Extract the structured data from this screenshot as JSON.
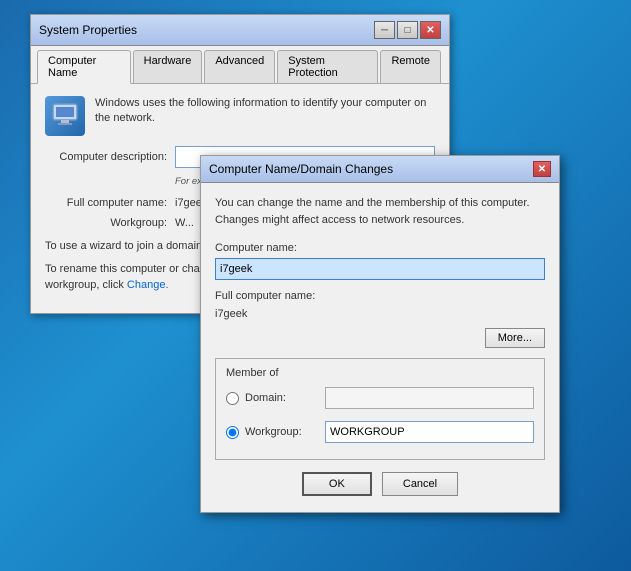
{
  "syswindow": {
    "title": "System Properties",
    "close": "✕",
    "minimize": "─",
    "maximize": "□",
    "tabs": [
      {
        "label": "Computer Name",
        "active": true
      },
      {
        "label": "Hardware",
        "active": false
      },
      {
        "label": "Advanced",
        "active": false
      },
      {
        "label": "System Protection",
        "active": false
      },
      {
        "label": "Remote",
        "active": false
      }
    ],
    "info_text": "Windows uses the following information to identify your computer on the network.",
    "desc_label": "Computer description:",
    "desc_placeholder": "",
    "hint": "For example: \"Kitchen Computer\" or \"Mary's Computer\".",
    "fullname_label": "Full computer name:",
    "fullname_value": "i7geek",
    "workgroup_label": "Workgroup:",
    "workgroup_value": "W...",
    "wizard_text": "To use a wizard to join a domain or workgroup, click Network ID.",
    "rename_text": "To rename this computer or change its domain or workgroup, click Change."
  },
  "dialog": {
    "title": "Computer Name/Domain Changes",
    "close": "✕",
    "desc": "You can change the name and the membership of this computer. Changes might affect access to network resources.",
    "computer_name_label": "Computer name:",
    "computer_name_value": "i7geek",
    "full_name_label": "Full computer name:",
    "full_name_value": "i7geek",
    "more_btn": "More...",
    "member_of_label": "Member of",
    "domain_label": "Domain:",
    "domain_value": "",
    "workgroup_label": "Workgroup:",
    "workgroup_value": "WORKGROUP",
    "ok_btn": "OK",
    "cancel_btn": "Cancel"
  }
}
